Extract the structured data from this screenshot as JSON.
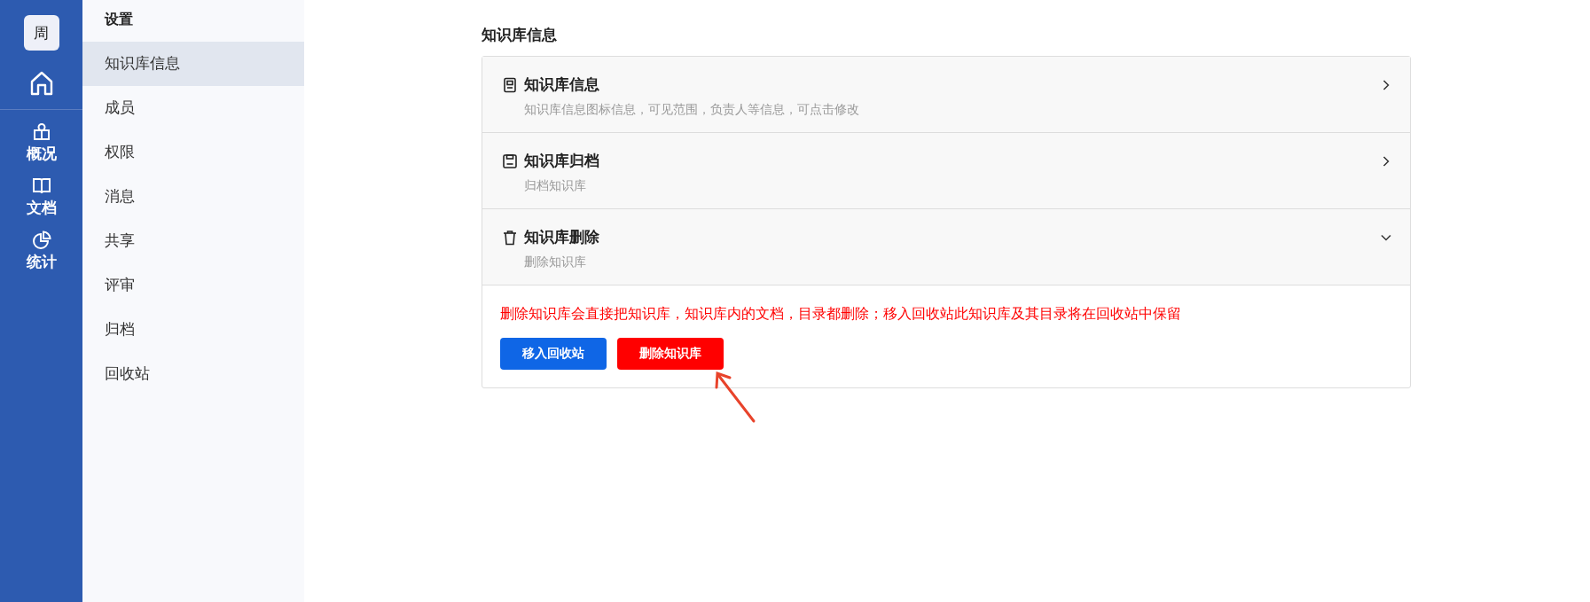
{
  "rail": {
    "avatar": "周",
    "items": [
      {
        "kind": "overview",
        "label": "概况"
      },
      {
        "kind": "docs",
        "label": "文档"
      },
      {
        "kind": "stats",
        "label": "统计"
      }
    ]
  },
  "settings": {
    "title": "设置",
    "items": [
      {
        "label": "知识库信息",
        "selected": true
      },
      {
        "label": "成员",
        "selected": false
      },
      {
        "label": "权限",
        "selected": false
      },
      {
        "label": "消息",
        "selected": false
      },
      {
        "label": "共享",
        "selected": false
      },
      {
        "label": "评审",
        "selected": false
      },
      {
        "label": "归档",
        "selected": false
      },
      {
        "label": "回收站",
        "selected": false
      }
    ]
  },
  "page_title": "知识库信息",
  "sections": [
    {
      "kind": "info",
      "title": "知识库信息",
      "subtitle": "知识库信息图标信息，可见范围，负责人等信息，可点击修改",
      "expanded": false
    },
    {
      "kind": "archive",
      "title": "知识库归档",
      "subtitle": "归档知识库",
      "expanded": false
    },
    {
      "kind": "delete",
      "title": "知识库删除",
      "subtitle": "删除知识库",
      "expanded": true,
      "warning": "删除知识库会直接把知识库，知识库内的文档，目录都删除；移入回收站此知识库及其目录将在回收站中保留",
      "buttons": [
        {
          "kind": "primary",
          "label": "移入回收站"
        },
        {
          "kind": "danger",
          "label": "删除知识库"
        }
      ]
    }
  ]
}
